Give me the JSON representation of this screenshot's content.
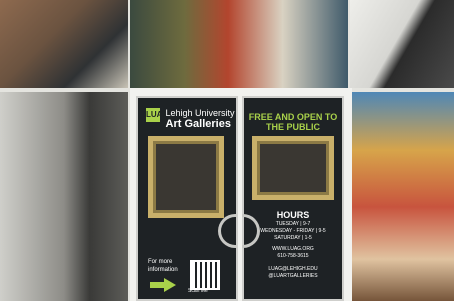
{
  "logo": {
    "mark": "LUAG",
    "line1": "Lehigh University",
    "line2": "Art Galleries"
  },
  "left_door": {
    "info": "For more information",
    "scan": "Scan Me"
  },
  "right_door": {
    "headline": "FREE AND OPEN TO THE PUBLIC",
    "hours_title": "HOURS",
    "hours_lines": [
      "TUESDAY | 9-7",
      "WEDNESDAY - FRIDAY | 9-5",
      "SATURDAY | 1-5"
    ],
    "web": "WWW.LUAG.ORG",
    "phone": "610-758-3615",
    "email": "LUAG@LEHIGH.EDU",
    "social": "@LUARTGALLERIES"
  },
  "colors": {
    "accent": "#a9d14a",
    "door": "#1e2225",
    "frame": "#c9b06a"
  }
}
